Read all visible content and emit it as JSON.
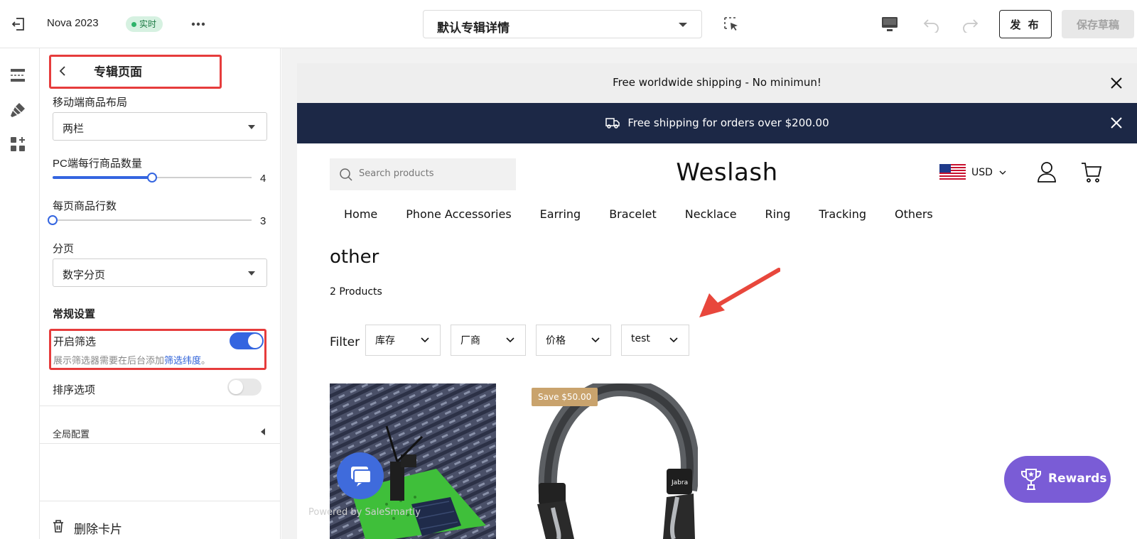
{
  "topbar": {
    "store_name": "Nova 2023",
    "live_badge": "实时",
    "page_selector": "默认专辑详情",
    "publish_label": "发 布",
    "save_draft_label": "保存草稿"
  },
  "panel": {
    "title": "专辑页面",
    "mobile_layout_label": "移动端商品布局",
    "mobile_layout_value": "两栏",
    "pc_per_row_label": "PC端每行商品数量",
    "pc_per_row_value": "4",
    "pc_per_row_fraction": 0.5,
    "rows_per_page_label": "每页商品行数",
    "rows_per_page_value": "3",
    "rows_per_page_fraction": 0.0,
    "pagination_label": "分页",
    "pagination_value": "数字分页",
    "general_section": "常规设置",
    "enable_filter_label": "开启筛选",
    "enable_filter_on": true,
    "filter_help_prefix": "展示筛选器需要在后台添加",
    "filter_help_link": "筛选纬度",
    "filter_help_suffix": "。",
    "sort_label": "排序选项",
    "sort_on": false,
    "global_config_label": "全局配置",
    "delete_card_label": "删除卡片"
  },
  "preview": {
    "announcement": "Free worldwide shipping - No minimun!",
    "shipping_bar": "Free shipping for orders over $200.00",
    "search_placeholder": "Search products",
    "logo": "Weslash",
    "currency": "USD",
    "nav": [
      "Home",
      "Phone Accessories",
      "Earring",
      "Bracelet",
      "Necklace",
      "Ring",
      "Tracking",
      "Others"
    ],
    "collection_title": "other",
    "product_count": "2 Products",
    "filter_label": "Filter",
    "filters": [
      "库存",
      "厂商",
      "价格",
      "test"
    ],
    "save_badge": "Save $50.00",
    "powered_by": "Powered by SaleSmartly",
    "rewards_label": "Rewards"
  },
  "colors": {
    "accent_blue": "#3465e0",
    "highlight_red": "#e63c3c",
    "shipping_bar_bg": "#1c2846",
    "rewards_purple": "#7a5cd6",
    "save_badge": "#c9a36d"
  }
}
